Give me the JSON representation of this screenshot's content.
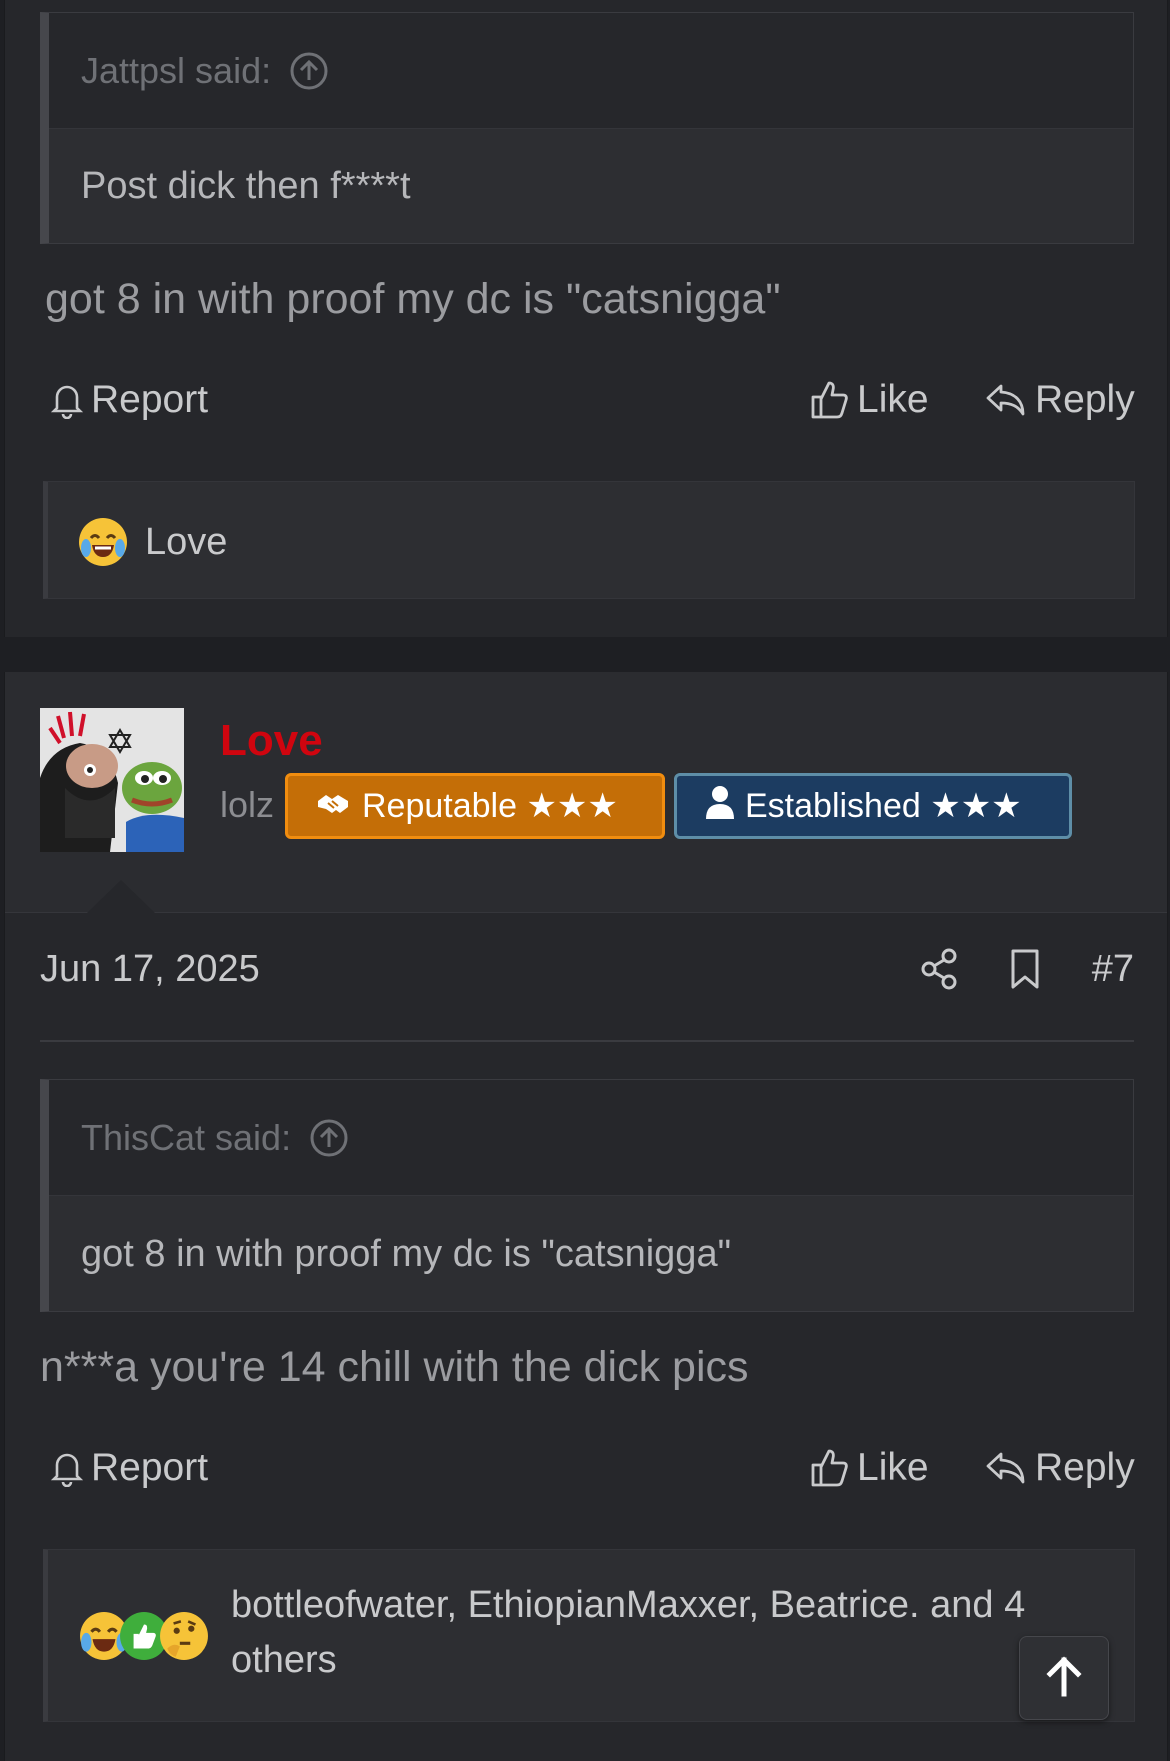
{
  "post1": {
    "quote": {
      "author": "Jattpsl said:",
      "text": "Post dick then f****t"
    },
    "body": "got 8 in with proof my dc is \"catsnigga\"",
    "actions": {
      "report": "Report",
      "like": "Like",
      "reply": "Reply"
    },
    "reactions": {
      "summary": "Love"
    }
  },
  "post2": {
    "user": {
      "name": "Love",
      "title": "lolz",
      "badges": [
        {
          "label": "Reputable ★★★",
          "color": "#c46e07"
        },
        {
          "label": "Established ★★★",
          "color": "#1c3c61"
        }
      ]
    },
    "meta": {
      "date": "Jun 17, 2025",
      "number": "#7"
    },
    "quote": {
      "author": "ThisCat said:",
      "text": "got 8 in with proof my dc is \"catsnigga\""
    },
    "body": "n***a you're 14 chill with the dick pics",
    "actions": {
      "report": "Report",
      "like": "Like",
      "reply": "Reply"
    },
    "reactions": {
      "line1": "bottleofwater, EthiopianMaxxer, Beatrice. and 4",
      "line2": "others",
      "icons": [
        "laugh-cry-emoji",
        "thumbs-up-emoji",
        "thinking-emoji"
      ]
    }
  },
  "colors": {
    "username": "#d0050f",
    "background": "#26272b"
  }
}
